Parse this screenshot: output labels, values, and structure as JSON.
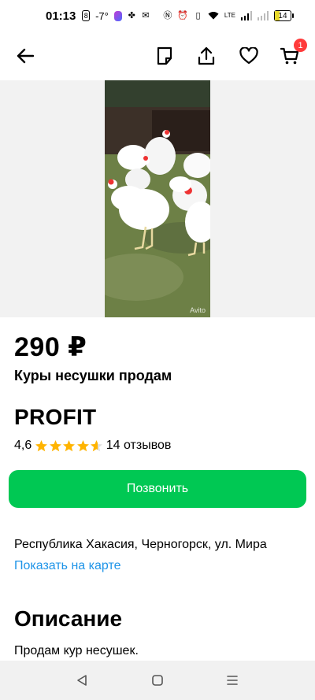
{
  "status_bar": {
    "time": "01:13",
    "temperature": "-7°",
    "battery": "14",
    "network_label": "LTE"
  },
  "header": {
    "cart_count": "1"
  },
  "gallery": {
    "watermark": "Avito"
  },
  "listing": {
    "price": "290 ₽",
    "title": "Куры несушки продам"
  },
  "seller": {
    "name": "PROFIT",
    "rating": "4,6",
    "rating_value": 4.6,
    "reviews": "14 отзывов"
  },
  "actions": {
    "call_label": "Позвонить"
  },
  "location": {
    "address": "Республика Хакасия, Черногорск, ул. Мира",
    "map_link": "Показать на карте"
  },
  "description": {
    "heading": "Описание",
    "text": "Продам кур несушек."
  },
  "colors": {
    "accent_green": "#00c853",
    "link_blue": "#1e94e8",
    "star_gold": "#ffb400",
    "badge_red": "#ff3b3b"
  }
}
